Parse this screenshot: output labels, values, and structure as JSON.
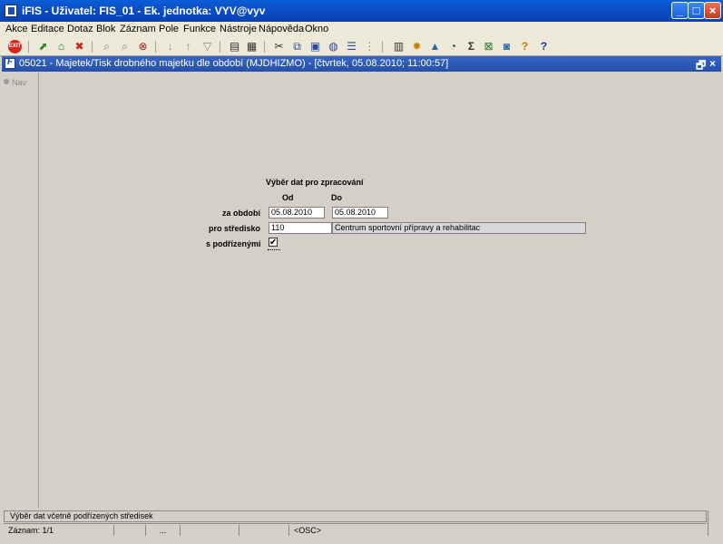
{
  "window": {
    "title": "iFIS - Uživatel: FIS_01 - Ek. jednotka: VYV@vyv",
    "controls": [
      "_",
      "□",
      "×"
    ]
  },
  "menu": [
    "Akce",
    "Editace",
    "Dotaz",
    "Blok",
    "Záznam",
    "Pole",
    "Funkce",
    "Nástroje",
    "Nápověda",
    "Okno"
  ],
  "toolbar": {
    "exit_label": "EXIT",
    "icons": [
      "save-icon",
      "print-icon",
      "delete-record-icon",
      "query-icon",
      "execute-query-icon",
      "cancel-query-icon",
      "sort-asc-icon",
      "sort-desc-icon",
      "filter-icon",
      "print-preview-icon",
      "export-icon",
      "cut-icon",
      "copy-icon",
      "paste-icon",
      "lov-icon",
      "edit-icon",
      "insert-icon",
      "sum-icon",
      "excel-icon",
      "help-icon"
    ]
  },
  "inner_window": {
    "title": "05021 - Majetek/Tisk drobného majetku dle období (MJDHIZMO) - [čtvrtek, 05.08.2010; 11:00:57]",
    "restore": "🗗",
    "close": "×"
  },
  "nav": {
    "label": "Nav"
  },
  "form": {
    "heading": "Výběr dat pro zpracování",
    "col_from": "Od",
    "col_to": "Do",
    "period_label": "za období",
    "period_from": "05.08.2010",
    "period_to": "05.08.2010",
    "center_label": "pro středisko",
    "center_code": "110",
    "center_name": "Centrum sportovní přípravy a rehabilitac",
    "sub_label": "s podřízenými",
    "sub_checked": "✔"
  },
  "status": {
    "hint": "Výběr dat včetně podřízených středisek",
    "record": "Záznam: 1/1",
    "dots": "...",
    "mode": "<OSC>"
  }
}
